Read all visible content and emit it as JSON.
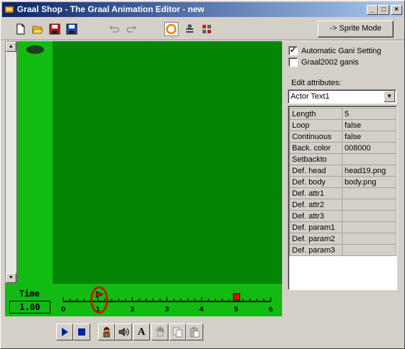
{
  "window": {
    "title": "Graal Shop - The Graal Animation Editor - new",
    "minimize_label": "_",
    "maximize_label": "□",
    "close_label": "×"
  },
  "toolbar": {
    "tools": [
      {
        "name": "new-file-icon"
      },
      {
        "name": "open-folder-icon"
      },
      {
        "name": "save-icon"
      },
      {
        "name": "save-as-icon"
      },
      {
        "name": "undo-icon",
        "disabled": true
      },
      {
        "name": "redo-icon",
        "disabled": true
      },
      {
        "name": "ring-icon",
        "active": true
      },
      {
        "name": "layers-icon"
      },
      {
        "name": "sprites-icon"
      }
    ],
    "sprite_mode_label": "-> Sprite Mode"
  },
  "timeline": {
    "time_label": "Time",
    "time_value": "1.00",
    "tick_labels": [
      "0",
      "1",
      "2",
      "3",
      "4",
      "5",
      "6"
    ],
    "current_frame": 1,
    "marker_frame": 5,
    "max": 6
  },
  "options": {
    "automatic_gani": {
      "label": "Automatic Gani Setting",
      "checked": true
    },
    "graal2002": {
      "label": "Graal2002 ganis",
      "checked": false
    }
  },
  "edit_attributes": {
    "label": "Edit attributes:",
    "selected": "Actor Text1",
    "rows": [
      {
        "key": "Length",
        "value": "5"
      },
      {
        "key": "Loop",
        "value": "false"
      },
      {
        "key": "Continuous",
        "value": "false"
      },
      {
        "key": "Back. color",
        "value": "008000"
      },
      {
        "key": "Setbackto",
        "value": ""
      },
      {
        "key": "Def. head",
        "value": "head19.png"
      },
      {
        "key": "Def. body",
        "value": "body.png"
      },
      {
        "key": "Def. attr1",
        "value": ""
      },
      {
        "key": "Def. attr2",
        "value": ""
      },
      {
        "key": "Def. attr3",
        "value": ""
      },
      {
        "key": "Def. param1",
        "value": ""
      },
      {
        "key": "Def. param2",
        "value": ""
      },
      {
        "key": "Def. param3",
        "value": ""
      }
    ]
  },
  "playback": {
    "tools": [
      {
        "name": "play-icon"
      },
      {
        "name": "stop-icon"
      },
      {
        "name": "character-icon"
      },
      {
        "name": "sound-icon"
      },
      {
        "name": "text-icon",
        "glyph": "A"
      },
      {
        "name": "hand-icon",
        "disabled": true
      },
      {
        "name": "copy-icon",
        "disabled": true
      },
      {
        "name": "paste-icon",
        "disabled": true
      }
    ]
  },
  "colors": {
    "canvas": "#048604",
    "canvas_side": "#11bb11",
    "title_start": "#0a246a",
    "title_end": "#a6caf0",
    "frame_marker": "#ff0000"
  }
}
